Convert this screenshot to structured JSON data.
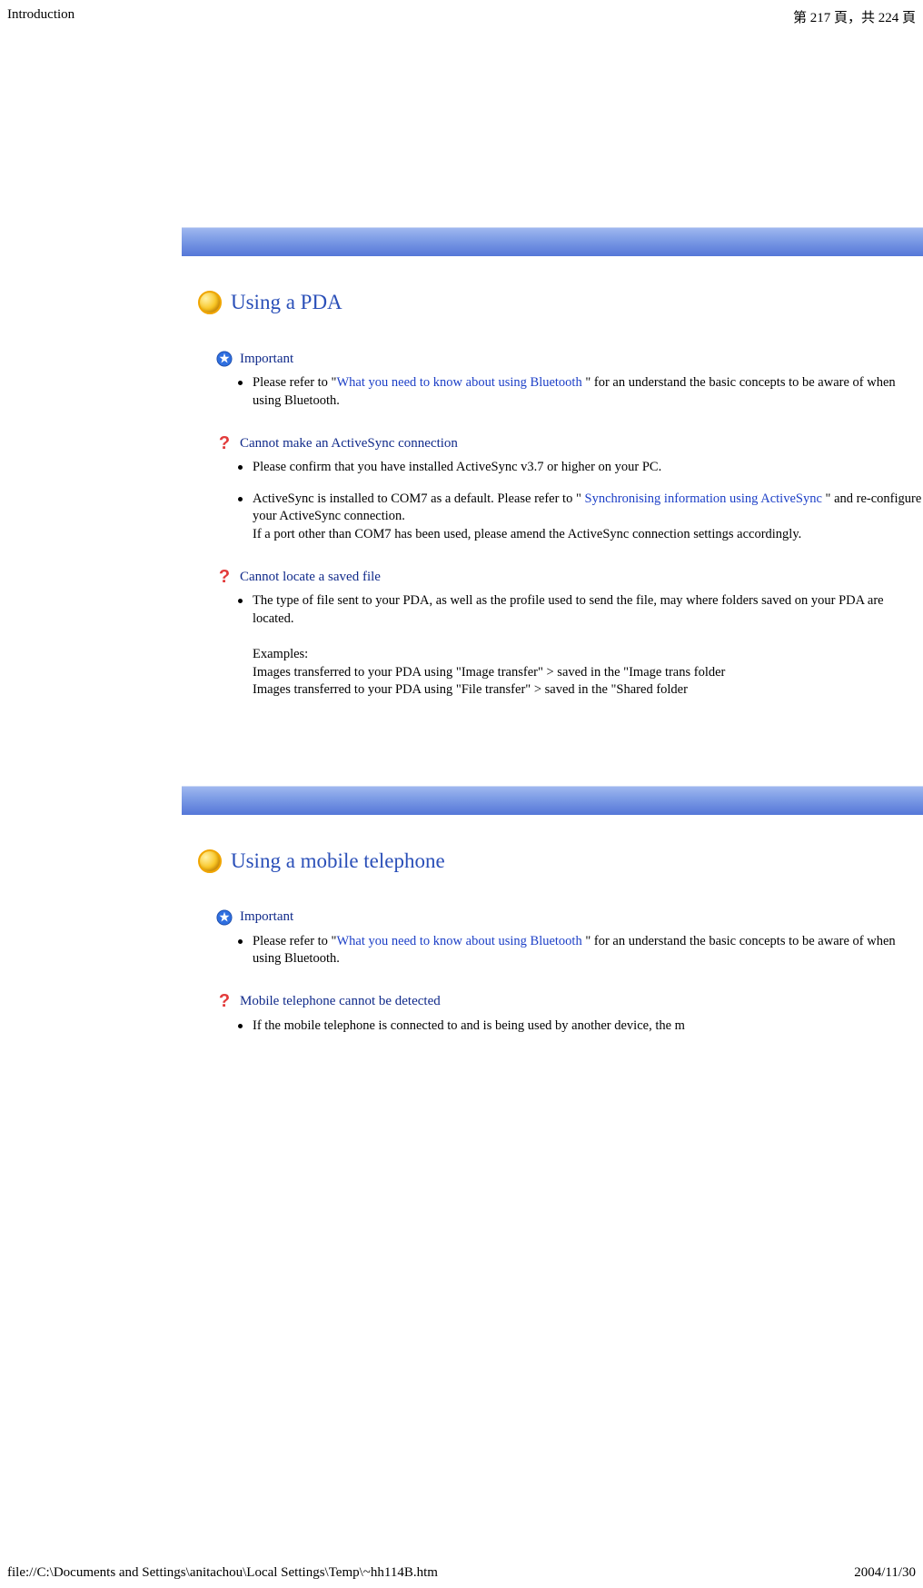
{
  "header": {
    "left": "Introduction",
    "right": "第 217 頁，共 224 頁"
  },
  "footer": {
    "left": "file://C:\\Documents and Settings\\anitachou\\Local Settings\\Temp\\~hh114B.htm",
    "right": "2004/11/30"
  },
  "section1": {
    "title": "Using a PDA",
    "important": {
      "label": "Important",
      "item": {
        "pre": "Please refer to \"",
        "link": "What you need to know about using Bluetooth",
        "post": " \" for an understand the basic concepts to be aware of when using Bluetooth."
      }
    },
    "q1": {
      "label": "Cannot make an ActiveSync connection",
      "item1": "Please confirm that you have installed ActiveSync v3.7 or higher on your PC.",
      "item2": {
        "pre": "ActiveSync is installed to COM7 as a default. Please refer to \" ",
        "link": "Synchronising information using ActiveSync",
        "post": " \" and re-configure your ActiveSync connection.\nIf a port other than COM7 has been used, please amend the ActiveSync connection settings accordingly."
      }
    },
    "q2": {
      "label": "Cannot locate a saved file",
      "item": "The type of file sent to your PDA, as well as the profile used to send the file, may where folders saved on your PDA are located.\n\nExamples:\nImages transferred to your PDA using \"Image transfer\" > saved in the \"Image trans folder\nImages transferred to your PDA using \"File transfer\" > saved in the \"Shared folder"
    }
  },
  "section2": {
    "title": "Using a mobile telephone",
    "important": {
      "label": "Important",
      "item": {
        "pre": "Please refer to \"",
        "link": "What you need to know about using Bluetooth",
        "post": " \" for an understand the basic concepts to be aware of when using Bluetooth."
      }
    },
    "q1": {
      "label": "Mobile telephone cannot be detected",
      "item": "If the mobile telephone is connected to and is being used by another device, the m"
    }
  }
}
